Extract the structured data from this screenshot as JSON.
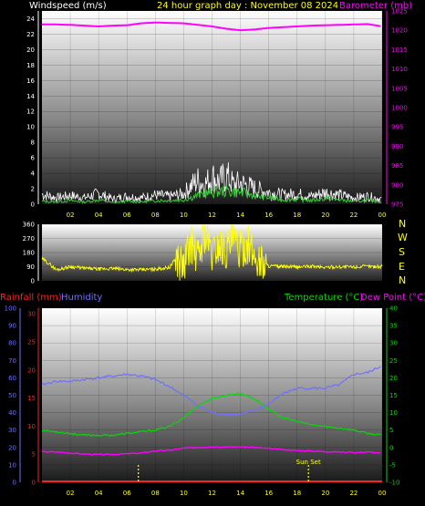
{
  "header": {
    "left": "Windspeed (m/s)",
    "center": "24 hour graph day : November 08 2024",
    "right": "Barometer (mb)"
  },
  "colors": {
    "windspeed_label": "#ffffff",
    "title": "#ffff00",
    "barometer": "#ff00ff",
    "gust": "#ffffff",
    "avg_wind": "#33cc33",
    "direction": "#ffff00",
    "rain": "#ff2020",
    "humidity": "#7070ff",
    "temperature": "#00dd00",
    "dew": "#ff00ff",
    "sun_marker": "#ffff00"
  },
  "time_ticks": [
    "02",
    "04",
    "06",
    "08",
    "10",
    "12",
    "14",
    "16",
    "18",
    "20",
    "22",
    "00"
  ],
  "panel_wind": {
    "left_axis_ticks": [
      "0",
      "2",
      "4",
      "6",
      "8",
      "10",
      "12",
      "14",
      "16",
      "18",
      "20",
      "22",
      "24"
    ],
    "right_axis_ticks": [
      "975",
      "980",
      "985",
      "990",
      "995",
      "1000",
      "1005",
      "1010",
      "1015",
      "1020",
      "1025"
    ]
  },
  "panel_direction": {
    "axis_ticks": [
      "0",
      "90",
      "180",
      "270",
      "360"
    ],
    "compass": [
      "N",
      "W",
      "S",
      "E",
      "N"
    ]
  },
  "panel_bottom": {
    "labels": {
      "rainfall": "Rainfall (mm)",
      "humidity": "Humidity",
      "temperature": "Temperature (°C)",
      "dew": "Dew Point (°C)"
    },
    "humidity_ticks": [
      "0",
      "10",
      "20",
      "30",
      "40",
      "50",
      "60",
      "70",
      "80",
      "90",
      "100"
    ],
    "rain_ticks": [
      "0",
      "5",
      "10",
      "15",
      "20",
      "25",
      "30"
    ],
    "temp_ticks": [
      "-10",
      "-5",
      "0",
      "5",
      "10",
      "15",
      "20",
      "25",
      "30",
      "35",
      "40"
    ],
    "sun_labels": {
      "sunset": "Sun Set"
    }
  },
  "chart_data": [
    {
      "type": "line",
      "x_range": [
        0,
        24
      ],
      "ylim_left": [
        0,
        25
      ],
      "ylim_right": [
        975,
        1025
      ],
      "series": [
        {
          "axis": "right",
          "x": [
            0,
            1,
            2,
            3,
            4,
            5,
            6,
            7,
            8,
            9,
            10,
            11,
            12,
            13,
            14,
            15,
            16,
            17,
            18,
            19,
            20,
            21,
            22,
            23,
            24
          ],
          "values": [
            1021.5,
            1021.5,
            1021.4,
            1021.2,
            1021.0,
            1021.2,
            1021.3,
            1021.8,
            1022.0,
            1021.9,
            1021.8,
            1021.4,
            1021.0,
            1020.4,
            1020.0,
            1020.2,
            1020.6,
            1020.8,
            1021.0,
            1021.2,
            1021.3,
            1021.4,
            1021.5,
            1021.6,
            1021.0
          ]
        },
        {
          "axis": "left",
          "x": [
            0,
            1,
            2,
            3,
            4,
            5,
            6,
            7,
            8,
            9,
            10,
            10.5,
            11,
            11.5,
            12,
            12.5,
            13,
            13.5,
            14,
            15,
            16,
            17,
            18,
            19,
            20,
            21,
            22,
            23,
            24
          ],
          "values": [
            1.5,
            1.0,
            1.3,
            1.0,
            1.6,
            0.8,
            1.2,
            1.0,
            1.4,
            1.2,
            1.6,
            2.8,
            3.6,
            3.0,
            4.2,
            3.4,
            4.4,
            3.0,
            3.2,
            2.4,
            1.8,
            1.4,
            1.6,
            1.2,
            1.8,
            1.4,
            1.0,
            1.2,
            0.8
          ]
        },
        {
          "axis": "left",
          "x": [
            0,
            1,
            2,
            3,
            4,
            5,
            6,
            7,
            8,
            9,
            10,
            11,
            12,
            13,
            14,
            15,
            16,
            17,
            18,
            19,
            20,
            21,
            22,
            23,
            24
          ],
          "values": [
            0.4,
            0.3,
            0.5,
            0.3,
            0.6,
            0.2,
            0.4,
            0.3,
            0.5,
            0.5,
            0.6,
            1.2,
            1.6,
            1.8,
            1.6,
            1.2,
            0.9,
            0.6,
            0.7,
            0.5,
            0.8,
            0.6,
            0.4,
            0.5,
            0.3
          ]
        }
      ]
    },
    {
      "type": "line",
      "x_range": [
        0,
        24
      ],
      "ylim": [
        0,
        360
      ],
      "series": [
        {
          "x": [
            0,
            0.5,
            1,
            2,
            3,
            4,
            5,
            6,
            7,
            8,
            9,
            9.5,
            10,
            10.5,
            11,
            11.5,
            12,
            12.5,
            13,
            13.5,
            14,
            14.5,
            15,
            15.5,
            16,
            17,
            18,
            19,
            20,
            21,
            22,
            23,
            24
          ],
          "values": [
            140,
            110,
            70,
            90,
            80,
            75,
            78,
            72,
            70,
            75,
            85,
            150,
            90,
            250,
            140,
            310,
            170,
            230,
            200,
            260,
            190,
            240,
            150,
            120,
            95,
            90,
            88,
            92,
            86,
            90,
            88,
            92,
            90
          ]
        }
      ]
    },
    {
      "type": "line",
      "x_range": [
        0,
        24
      ],
      "ylim_humidity": [
        0,
        100
      ],
      "ylim_temp": [
        -10,
        40
      ],
      "series": [
        {
          "axis": "humidity",
          "x": [
            0,
            1,
            2,
            3,
            4,
            5,
            6,
            7,
            8,
            9,
            10,
            11,
            12,
            13,
            14,
            15,
            16,
            17,
            18,
            19,
            20,
            21,
            22,
            23,
            24
          ],
          "values": [
            56,
            58,
            58,
            59,
            60,
            61,
            62,
            61,
            59,
            55,
            50,
            44,
            40,
            39,
            39,
            41,
            45,
            51,
            54,
            54,
            54,
            56,
            62,
            63,
            67
          ]
        },
        {
          "axis": "temp",
          "x": [
            0,
            1,
            2,
            3,
            4,
            5,
            6,
            7,
            8,
            9,
            10,
            11,
            12,
            13,
            14,
            15,
            16,
            17,
            18,
            19,
            20,
            21,
            22,
            23,
            24
          ],
          "values": [
            5,
            4.5,
            4,
            3.5,
            3.5,
            3.5,
            4,
            4.5,
            5,
            6,
            8.5,
            12,
            14,
            15,
            15.5,
            14,
            11,
            8.5,
            7.5,
            6.5,
            6,
            5.5,
            5,
            4,
            3.5
          ]
        },
        {
          "axis": "temp",
          "x": [
            0,
            1,
            2,
            3,
            4,
            5,
            6,
            7,
            8,
            9,
            10,
            11,
            12,
            13,
            14,
            15,
            16,
            17,
            18,
            19,
            20,
            21,
            22,
            23,
            24
          ],
          "values": [
            -1.2,
            -1.3,
            -1.6,
            -1.9,
            -2.0,
            -2.0,
            -1.8,
            -1.6,
            -1.0,
            -0.8,
            -0.2,
            0,
            0.2,
            0.1,
            0.2,
            0,
            -0.3,
            -0.6,
            -0.9,
            -1.0,
            -1.2,
            -1.3,
            -1.5,
            -1.3,
            -1.7
          ]
        },
        {
          "axis": "rain",
          "x": [
            0,
            24
          ],
          "values": [
            0,
            0
          ]
        }
      ],
      "markers": [
        {
          "label": "",
          "x": 6.8
        },
        {
          "label": "Sun Set",
          "x": 18.8
        }
      ]
    }
  ]
}
